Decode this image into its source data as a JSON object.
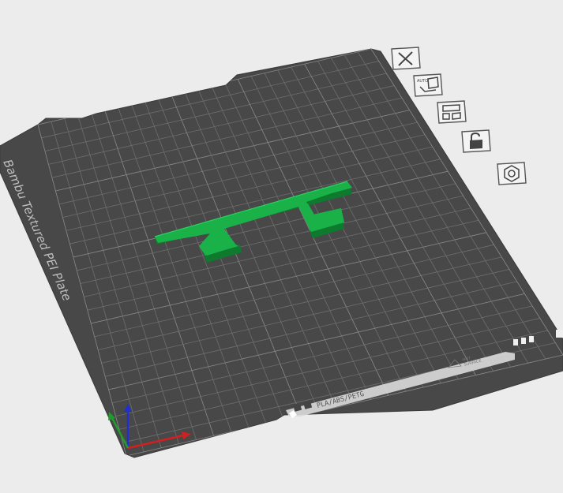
{
  "plate": {
    "name": "Bambu Textured PEI Plate",
    "filament_label": "PLA/ABS/PETG",
    "hot_surface_line1": "HOT",
    "hot_surface_line2": "SURFACE",
    "auto_label": "AUTO"
  },
  "toolbar": {
    "buttons": [
      {
        "name": "remove-plate-button",
        "icon": "close-icon"
      },
      {
        "name": "auto-arrange-button",
        "icon": "auto-orient-icon"
      },
      {
        "name": "arrange-button",
        "icon": "arrange-icon"
      },
      {
        "name": "lock-plate-button",
        "icon": "unlock-icon"
      },
      {
        "name": "plate-settings-button",
        "icon": "hex-settings-icon"
      }
    ]
  },
  "colors": {
    "background": "#ececec",
    "plate": "#484848",
    "grid": "#7a7a7a",
    "model": "#16a843",
    "axis_x": "#d21f1f",
    "axis_y": "#1f9d2c",
    "axis_z": "#1f2fd2"
  }
}
